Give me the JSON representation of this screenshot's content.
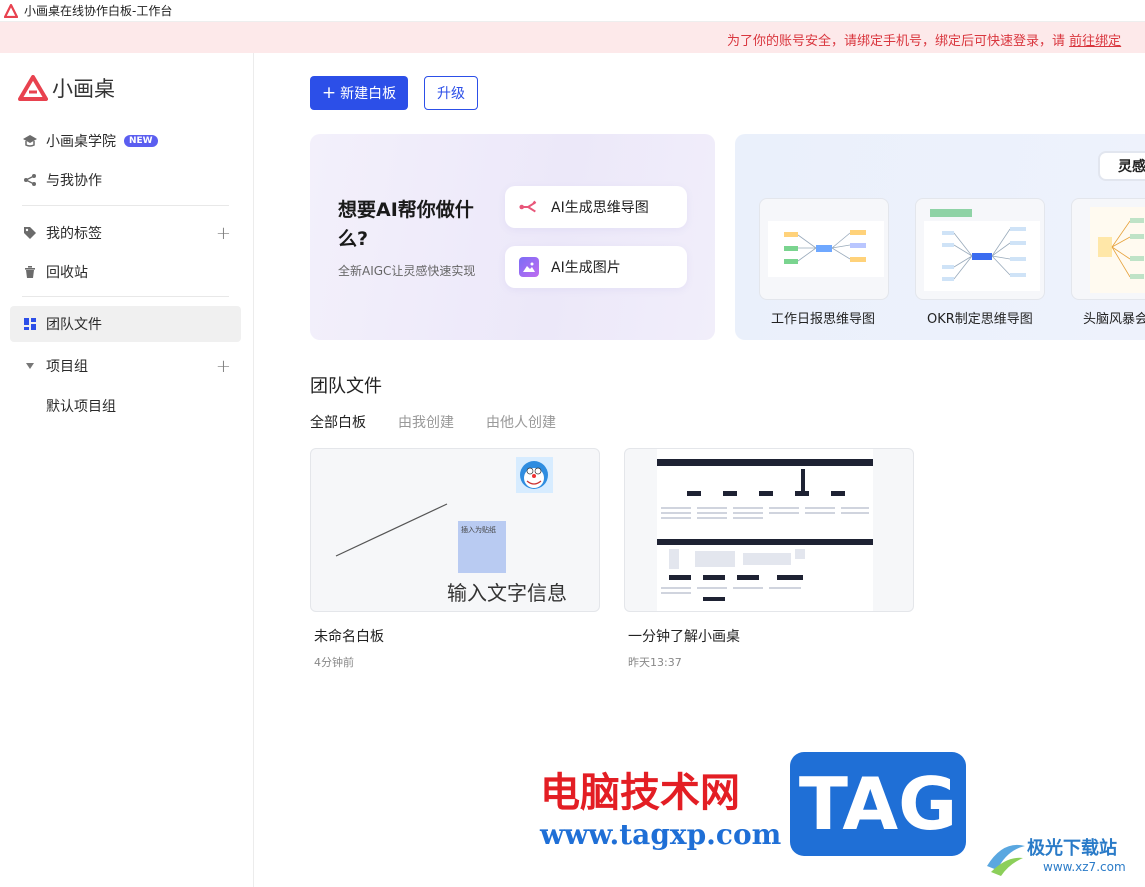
{
  "window": {
    "title": "小画桌在线协作白板-工作台"
  },
  "notice": {
    "text": "为了你的账号安全，请绑定手机号，绑定后可快速登录，请 ",
    "link": "前往绑定"
  },
  "sidebar": {
    "brand": "小画桌",
    "academy": "小画桌学院",
    "academy_badge": "NEW",
    "collab": "与我协作",
    "tags": "我的标签",
    "trash": "回收站",
    "team_files": "团队文件",
    "project_group": "项目组",
    "default_group": "默认项目组"
  },
  "toolbar": {
    "new_board": "新建白板",
    "upgrade": "升级"
  },
  "ai_card": {
    "title": "想要AI帮你做什么?",
    "subtitle": "全新AIGC让灵感快速实现",
    "btn_mindmap": "AI生成思维导图",
    "btn_image": "AI生成图片"
  },
  "inspiration": {
    "tab": "灵感",
    "templates": [
      {
        "caption": "工作日报思维导图"
      },
      {
        "caption": "OKR制定思维导图"
      },
      {
        "caption": "头脑风暴会"
      }
    ]
  },
  "files_section": {
    "title": "团队文件",
    "filters": [
      "全部白板",
      "由我创建",
      "由他人创建"
    ],
    "files": [
      {
        "name": "未命名白板",
        "time": "4分钟前",
        "note_text": "输入文字信息",
        "sticky_text": "插入为贴纸"
      },
      {
        "name": "一分钟了解小画桌",
        "time": "昨天13:37"
      }
    ]
  },
  "watermark": {
    "cn": "电脑技术网",
    "url": "www.tagxp.com",
    "tag": "TAG",
    "site": "极光下载站",
    "site_url": "www.xz7.com"
  },
  "colors": {
    "primary": "#2c4fe8",
    "notice_bg": "#fde9ea",
    "notice_text": "#d9363e",
    "badge": "#5b5ef0",
    "brand_red": "#e8424f"
  }
}
